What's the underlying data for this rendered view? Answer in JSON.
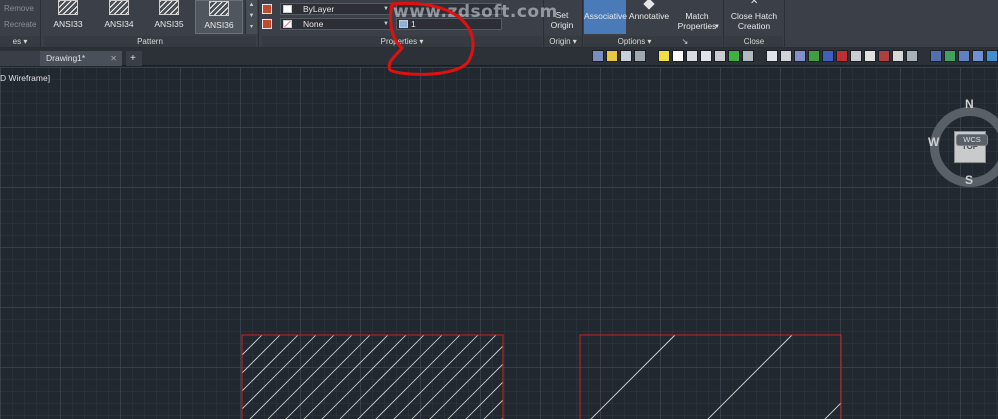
{
  "ribbon": {
    "left_tools": {
      "remove": "Remove",
      "recreate": "Recreate"
    },
    "left_panel_title": "es",
    "pattern": {
      "title": "Pattern",
      "swatches": [
        "ANSI33",
        "ANSI34",
        "ANSI35",
        "ANSI36"
      ]
    },
    "properties": {
      "title": "Properties",
      "hatch_color": "ByLayer",
      "background_color": "None",
      "scale_value": "1"
    },
    "origin": {
      "title": "Origin",
      "set_origin": "Set Origin"
    },
    "options": {
      "title": "Options",
      "associative": "Associative",
      "annotative": "Annotative",
      "match_properties": "Match Properties"
    },
    "close": {
      "title": "Close",
      "close_hatch": "Close Hatch Creation"
    }
  },
  "watermark": "www.zdsoft.com",
  "tabs": {
    "drawing": "Drawing1*",
    "add": "+"
  },
  "viewport": {
    "label": "D Wireframe]",
    "viewcube": {
      "north": "N",
      "south": "S",
      "west": "W",
      "face": "TOP"
    },
    "wcs": "WCS"
  },
  "colors": {
    "ribbon_bg": "#3b4048",
    "viewport_bg": "#212830",
    "boundary": "#d42020",
    "annotation": "#e01010",
    "associative_active": "#4a7ab8"
  }
}
